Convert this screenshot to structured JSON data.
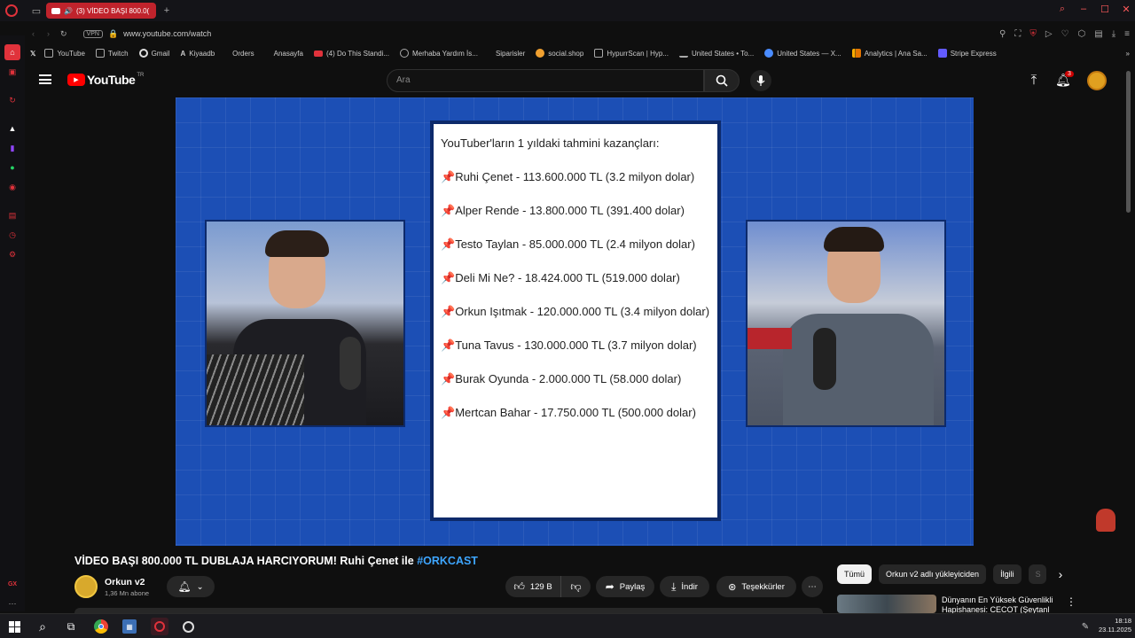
{
  "browser": {
    "tab_title": "(3) VİDEO BAŞI 800.0(",
    "url": "www.youtube.com/watch",
    "vpn_label": "VPN",
    "bookmarks": [
      "YouTube",
      "Twitch",
      "Gmail",
      "Kiyaadb",
      "Orders",
      "Anasayfa",
      "(4) Do This Standi...",
      "Merhaba Yardım İs...",
      "Siparisler",
      "social.shop",
      "HypurrScan | Hyp...",
      "United States • To...",
      "United States — X...",
      "Analytics | Ana Sa...",
      "Stripe Express"
    ],
    "sidebar_label": "GX"
  },
  "youtube": {
    "logo_text": "YouTube",
    "logo_region": "TR",
    "search_placeholder": "Ara",
    "notification_count": "3"
  },
  "video_card": {
    "heading": "YouTuber'ların 1 yıldaki tahmini kazançları:",
    "pin_icon": "📌",
    "entries": [
      "Ruhi Çenet - 113.600.000 TL (3.2 milyon dolar)",
      "Alper Rende - 13.800.000 TL (391.400 dolar)",
      "Testo Taylan - 85.000.000 TL (2.4 milyon dolar)",
      "Deli Mi Ne? - 18.424.000 TL (519.000 dolar)",
      "Orkun Işıtmak - 120.000.000 TL (3.4 milyon dolar)",
      "Tuna Tavus - 130.000.000 TL (3.7 milyon dolar)",
      "Burak Oyunda - 2.000.000 TL (58.000 dolar)",
      "Mertcan Bahar - 17.750.000 TL (500.000 dolar)"
    ]
  },
  "watch": {
    "title": "VİDEO BAŞI 800.000 TL DUBLAJA HARCIYORUM! Ruhi Çenet ile",
    "hashtag": "#ORKCAST",
    "channel_name": "Orkun v2",
    "subscribers": "1,36 Mn abone",
    "likes": "129 B",
    "share_label": "Paylaş",
    "download_label": "İndir",
    "thanks_label": "Teşekkürler",
    "more_label": "⋯"
  },
  "related": {
    "chips": [
      "Tümü",
      "Orkun v2 adlı yükleyiciden",
      "İlgili",
      "S"
    ],
    "first_title": "Dünyanın En Yüksek Güvenlikli Hapishanesi: CECOT (Şeytanl"
  },
  "taskbar": {
    "time": "18:18",
    "date": "23.11.2025"
  }
}
